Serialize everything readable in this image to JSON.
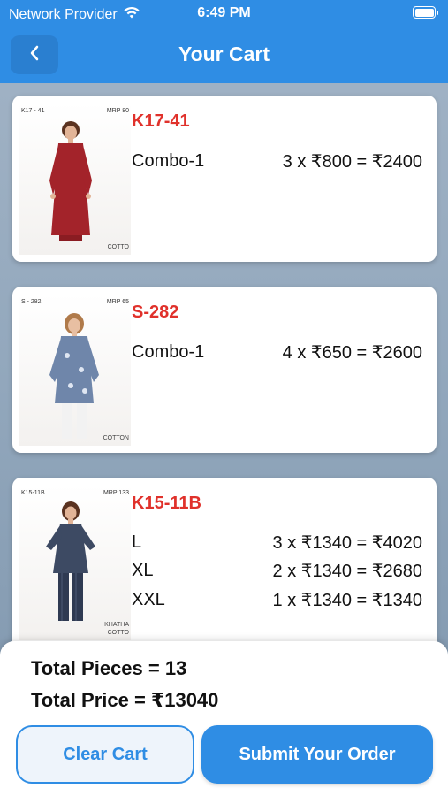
{
  "status_bar": {
    "carrier": "Network Provider",
    "time": "6:49 PM"
  },
  "header": {
    "title": "Your Cart"
  },
  "cart_items": [
    {
      "design_code": "K17-41",
      "thumb_code": "K17 - 41",
      "thumb_mrp": "MRP 80",
      "thumb_footer": "COTTO",
      "lines": [
        {
          "size": "Combo-1",
          "calc": "3 x ₹800 = ₹2400"
        }
      ]
    },
    {
      "design_code": "S-282",
      "thumb_code": "S - 282",
      "thumb_mrp": "MRP 65",
      "thumb_footer": "COTTON",
      "lines": [
        {
          "size": "Combo-1",
          "calc": "4 x ₹650 = ₹2600"
        }
      ]
    },
    {
      "design_code": "K15-11B",
      "thumb_code": "K15-11B",
      "thumb_mrp": "MRP 133",
      "thumb_footer": "KHATHA\nCOTTO",
      "lines": [
        {
          "size": "L",
          "calc": "3 x ₹1340 = ₹4020"
        },
        {
          "size": "XL",
          "calc": "2 x ₹1340 = ₹2680"
        },
        {
          "size": "XXL",
          "calc": "1 x ₹1340 = ₹1340"
        }
      ]
    }
  ],
  "summary": {
    "total_pieces": "Total Pieces = 13",
    "total_price": "Total Price = ₹13040"
  },
  "actions": {
    "clear_label": "Clear Cart",
    "submit_label": "Submit Your Order"
  },
  "colors": {
    "primary": "#2f8de4",
    "design_code": "#e0312b"
  },
  "icons": [
    "wifi-icon",
    "battery-icon",
    "chevron-left-icon"
  ]
}
